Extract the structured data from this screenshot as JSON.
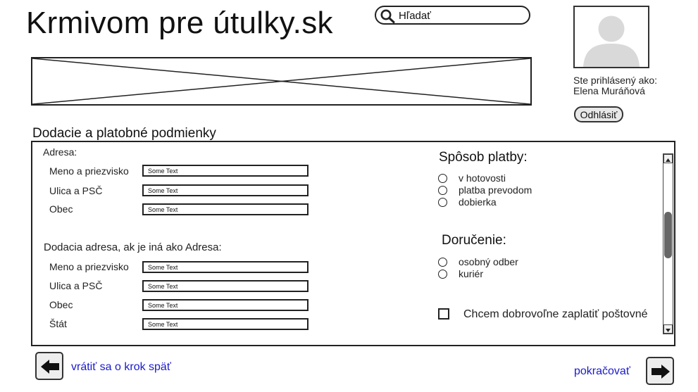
{
  "header": {
    "site_title": "Krmivom pre útulky.sk",
    "search_placeholder": "Hľadať"
  },
  "user": {
    "logged_in_label": "Ste prihlásený ako:",
    "name": "Elena Muráňová",
    "logout_label": "Odhlásiť"
  },
  "form": {
    "section_title": "Dodacie a platobné podmienky",
    "address": {
      "heading": "Adresa:",
      "fields": [
        {
          "label": "Meno a priezvisko",
          "value": "Some Text"
        },
        {
          "label": "Ulica a PSČ",
          "value": "Some Text"
        },
        {
          "label": "Obec",
          "value": "Some Text"
        }
      ]
    },
    "delivery_address": {
      "heading": "Dodacia adresa, ak je iná ako Adresa:",
      "fields": [
        {
          "label": "Meno a priezvisko",
          "value": "Some Text"
        },
        {
          "label": "Ulica a PSČ",
          "value": "Some Text"
        },
        {
          "label": "Obec",
          "value": "Some Text"
        },
        {
          "label": "Štát",
          "value": "Some Text"
        }
      ]
    },
    "payment": {
      "heading": "Spôsob platby:",
      "options": [
        "v hotovosti",
        "platba prevodom",
        "dobierka"
      ]
    },
    "shipping": {
      "heading": "Doručenie:",
      "options": [
        "osobný odber",
        "kuriér"
      ]
    },
    "voluntary_postage_label": "Chcem dobrovoľne zaplatiť poštovné"
  },
  "navigation": {
    "back_label": "vrátiť sa o krok späť",
    "continue_label": "pokračovať"
  },
  "icons": {
    "search": "search-icon",
    "avatar": "user-avatar-icon",
    "back": "arrow-left-icon",
    "forward": "arrow-right-icon"
  }
}
